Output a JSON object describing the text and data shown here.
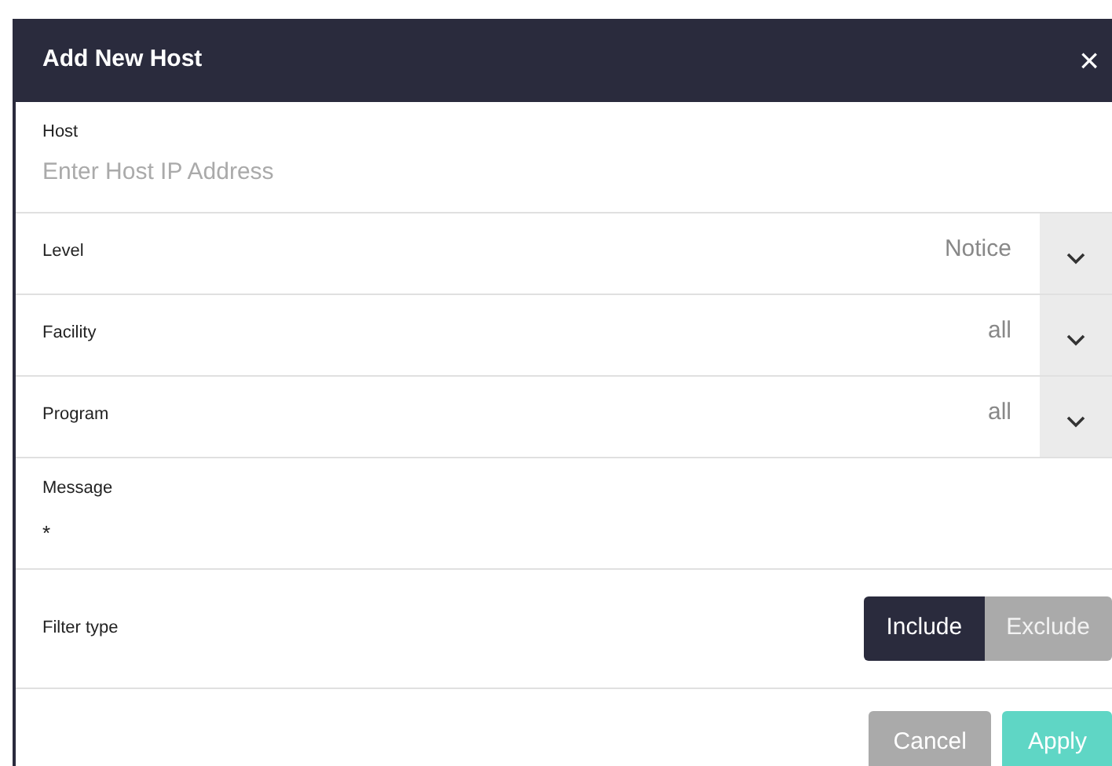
{
  "dialog": {
    "title": "Add New Host",
    "close": "×"
  },
  "host": {
    "label": "Host",
    "placeholder": "Enter Host IP Address"
  },
  "selects": [
    {
      "label": "Level",
      "value": "Notice"
    },
    {
      "label": "Facility",
      "value": "all"
    },
    {
      "label": "Program",
      "value": "all"
    }
  ],
  "message": {
    "label": "Message",
    "value": "*"
  },
  "filter_type": {
    "label": "Filter type",
    "options": [
      {
        "label": "Include",
        "selected": true
      },
      {
        "label": "Exclude",
        "selected": false
      }
    ]
  },
  "buttons": [
    {
      "label": "Cancel",
      "kind": "secondary"
    },
    {
      "label": "Apply",
      "kind": "primary"
    }
  ]
}
